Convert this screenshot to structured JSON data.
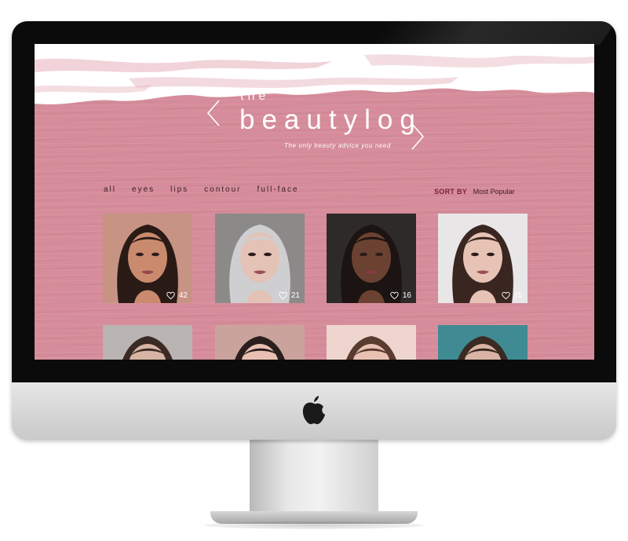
{
  "site": {
    "logo_small": "the",
    "logo_main": "beautylog",
    "tagline": "The only beauty advice you need"
  },
  "nav": {
    "items": [
      {
        "label": "all"
      },
      {
        "label": "eyes"
      },
      {
        "label": "lips"
      },
      {
        "label": "contour"
      },
      {
        "label": "full-face"
      }
    ]
  },
  "sort": {
    "label": "SORT BY",
    "value": "Most Popular"
  },
  "posts": [
    {
      "likes": "42",
      "skin": "#c98a6e",
      "bg": "#c79483",
      "hair": "#2a1a15"
    },
    {
      "likes": "21",
      "skin": "#e4c2b6",
      "bg": "#8c8a88",
      "hair": "#cfcfd2"
    },
    {
      "likes": "16",
      "skin": "#6b4232",
      "bg": "#2e2a2a",
      "hair": "#1b1412"
    },
    {
      "likes": "15",
      "skin": "#e6c3b5",
      "bg": "#e9e6e8",
      "hair": "#3a2620"
    },
    {
      "likes": "",
      "skin": "#d7b4a4",
      "bg": "#b9b3b1",
      "hair": "#3b2a24"
    },
    {
      "likes": "",
      "skin": "#e9bfb3",
      "bg": "#caa39c",
      "hair": "#2a1f1d"
    },
    {
      "likes": "",
      "skin": "#e8c1b3",
      "bg": "#eed6cf",
      "hair": "#5a3b2f"
    },
    {
      "likes": "",
      "skin": "#d9b3a4",
      "bg": "#3f8a93",
      "hair": "#3a2a22"
    }
  ],
  "colors": {
    "screen_pink": "#d68c9a",
    "sort_label": "#7a1f38",
    "nav_text": "#3a1e25"
  },
  "icons": {
    "prev": "chevron-left-icon",
    "next": "chevron-right-icon",
    "like": "heart-icon",
    "brand": "apple-logo"
  }
}
